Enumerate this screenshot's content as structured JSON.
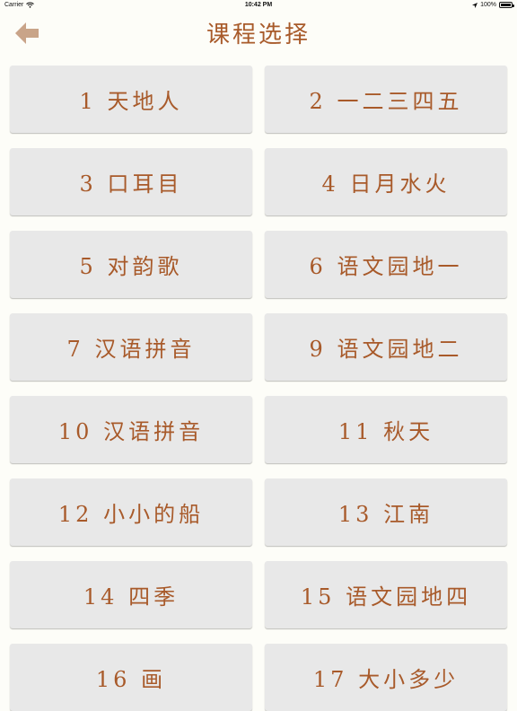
{
  "status_bar": {
    "carrier": "Carrier",
    "time": "10:42 PM",
    "battery_percent": "100%",
    "battery_level": 1.0
  },
  "header": {
    "title": "课程选择",
    "back_icon": "back-arrow-icon",
    "accent_color": "#a85a2a",
    "back_icon_color": "#c9a489"
  },
  "lessons": [
    {
      "label": "1 天地人"
    },
    {
      "label": "2 一二三四五"
    },
    {
      "label": "3 口耳目"
    },
    {
      "label": "4 日月水火"
    },
    {
      "label": "5 对韵歌"
    },
    {
      "label": "6 语文园地一"
    },
    {
      "label": "7 汉语拼音"
    },
    {
      "label": "9 语文园地二"
    },
    {
      "label": "10 汉语拼音"
    },
    {
      "label": "11 秋天"
    },
    {
      "label": "12 小小的船"
    },
    {
      "label": "13 江南"
    },
    {
      "label": "14 四季"
    },
    {
      "label": "15 语文园地四"
    },
    {
      "label": "16 画"
    },
    {
      "label": "17 大小多少"
    }
  ]
}
